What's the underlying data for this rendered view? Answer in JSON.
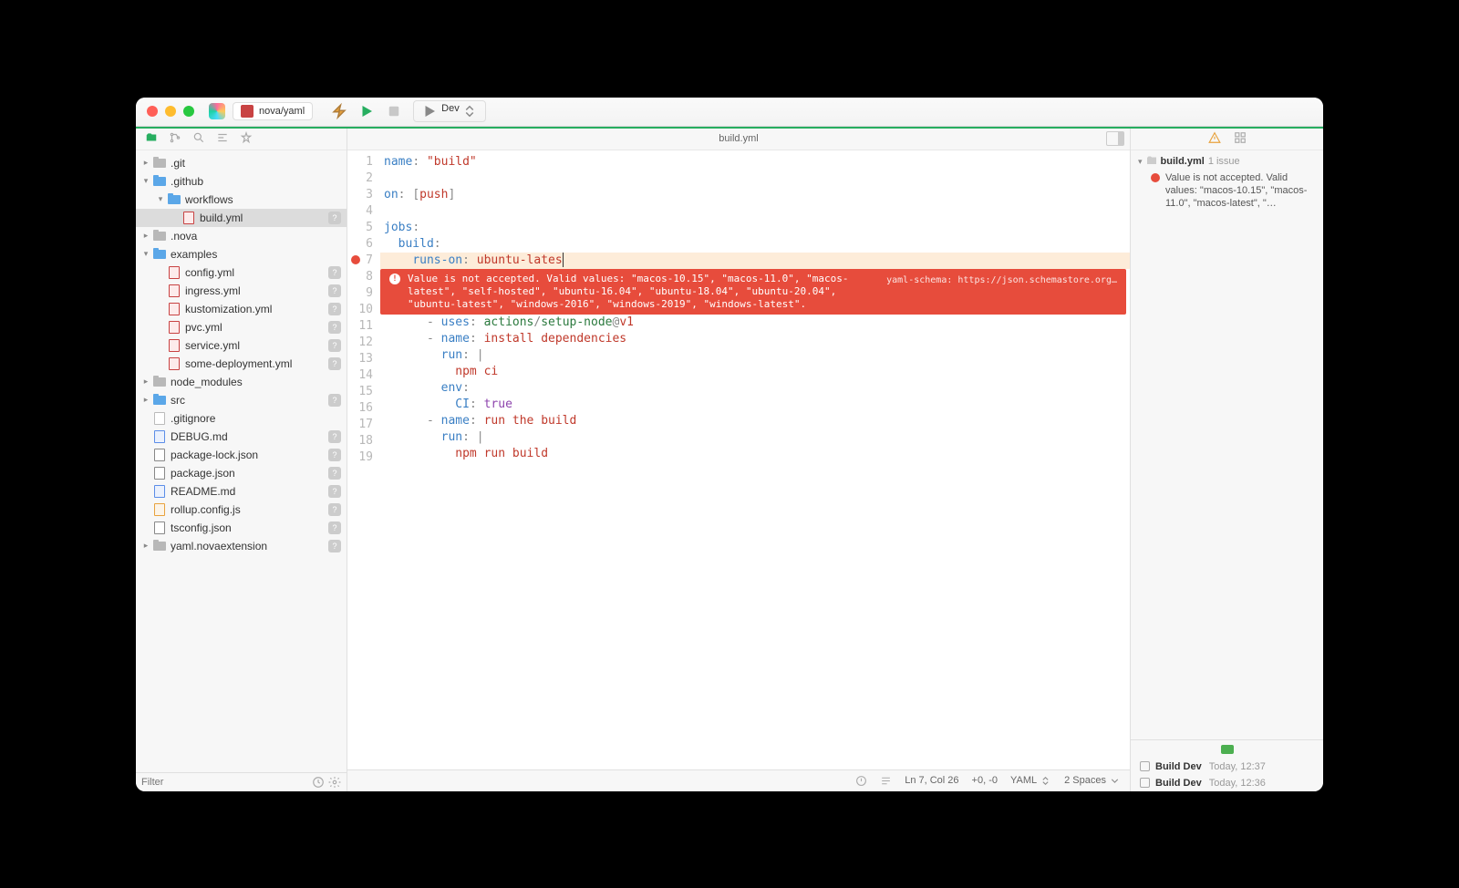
{
  "titlebar": {
    "project": "nova/yaml",
    "run_config": "Dev"
  },
  "sidebar": {
    "filter_placeholder": "Filter",
    "tree": [
      {
        "depth": 0,
        "type": "folder",
        "name": ".git",
        "expanded": false,
        "gray": true,
        "disclosure": true
      },
      {
        "depth": 0,
        "type": "folder",
        "name": ".github",
        "expanded": true,
        "disclosure": true
      },
      {
        "depth": 1,
        "type": "folder",
        "name": "workflows",
        "expanded": true,
        "disclosure": true
      },
      {
        "depth": 2,
        "type": "file",
        "name": "build.yml",
        "filetype": "yaml",
        "selected": true,
        "badge": "?"
      },
      {
        "depth": 0,
        "type": "folder",
        "name": ".nova",
        "expanded": false,
        "gray": true,
        "disclosure": true
      },
      {
        "depth": 0,
        "type": "folder",
        "name": "examples",
        "expanded": true,
        "disclosure": true
      },
      {
        "depth": 1,
        "type": "file",
        "name": "config.yml",
        "filetype": "yaml",
        "badge": "?"
      },
      {
        "depth": 1,
        "type": "file",
        "name": "ingress.yml",
        "filetype": "yaml",
        "badge": "?"
      },
      {
        "depth": 1,
        "type": "file",
        "name": "kustomization.yml",
        "filetype": "yaml",
        "badge": "?"
      },
      {
        "depth": 1,
        "type": "file",
        "name": "pvc.yml",
        "filetype": "yaml",
        "badge": "?"
      },
      {
        "depth": 1,
        "type": "file",
        "name": "service.yml",
        "filetype": "yaml",
        "badge": "?"
      },
      {
        "depth": 1,
        "type": "file",
        "name": "some-deployment.yml",
        "filetype": "yaml",
        "badge": "?"
      },
      {
        "depth": 0,
        "type": "folder",
        "name": "node_modules",
        "expanded": false,
        "gray": true,
        "disclosure": true
      },
      {
        "depth": 0,
        "type": "folder",
        "name": "src",
        "expanded": false,
        "disclosure": true,
        "badge": "?"
      },
      {
        "depth": 0,
        "type": "file",
        "name": ".gitignore",
        "filetype": "txt"
      },
      {
        "depth": 0,
        "type": "file",
        "name": "DEBUG.md",
        "filetype": "md",
        "badge": "?"
      },
      {
        "depth": 0,
        "type": "file",
        "name": "package-lock.json",
        "filetype": "json",
        "badge": "?"
      },
      {
        "depth": 0,
        "type": "file",
        "name": "package.json",
        "filetype": "json",
        "badge": "?"
      },
      {
        "depth": 0,
        "type": "file",
        "name": "README.md",
        "filetype": "md",
        "badge": "?"
      },
      {
        "depth": 0,
        "type": "file",
        "name": "rollup.config.js",
        "filetype": "js",
        "badge": "?"
      },
      {
        "depth": 0,
        "type": "file",
        "name": "tsconfig.json",
        "filetype": "json",
        "badge": "?"
      },
      {
        "depth": 0,
        "type": "folder",
        "name": "yaml.novaextension",
        "expanded": false,
        "gray": true,
        "disclosure": true,
        "badge": "?"
      }
    ]
  },
  "editor": {
    "filename": "build.yml",
    "error_line": 7,
    "error_banner": {
      "message": "Value is not accepted. Valid values: \"macos-10.15\", \"macos-11.0\", \"macos-latest\", \"self-hosted\", \"ubuntu-16.04\", \"ubuntu-18.04\", \"ubuntu-20.04\", \"ubuntu-latest\", \"windows-2016\", \"windows-2019\", \"windows-latest\".",
      "source": "yaml-schema: https://json.schemastore.org…"
    },
    "lines": [
      {
        "n": 1,
        "html": "<span class='tok-key'>name</span><span class='tok-punc'>:</span> <span class='tok-str'>\"build\"</span>"
      },
      {
        "n": 2,
        "html": ""
      },
      {
        "n": 3,
        "html": "<span class='tok-key'>on</span><span class='tok-punc'>:</span> <span class='tok-punc'>[</span><span class='tok-val'>push</span><span class='tok-punc'>]</span>"
      },
      {
        "n": 4,
        "html": ""
      },
      {
        "n": 5,
        "html": "<span class='tok-key'>jobs</span><span class='tok-punc'>:</span>"
      },
      {
        "n": 6,
        "html": "  <span class='tok-key'>build</span><span class='tok-punc'>:</span>"
      },
      {
        "n": 7,
        "html": "    <span class='tok-key'>runs-on</span><span class='tok-punc'>:</span> <span class='tok-val'>ubuntu-lates</span><span class='text-cursor'></span>",
        "err": true
      },
      {
        "n": 8,
        "banner": true
      },
      {
        "n": 9,
        "banner_cont": true
      },
      {
        "n": 10,
        "html": "      <span class='tok-punc'>-</span> <span class='tok-key'>uses</span><span class='tok-punc'>:</span> <span class='tok-fn'>actions</span><span class='tok-punc'>/</span><span class='tok-fn'>setup-node</span><span class='tok-punc'>@</span><span class='tok-val'>v1</span>"
      },
      {
        "n": 11,
        "html": "      <span class='tok-punc'>-</span> <span class='tok-key'>name</span><span class='tok-punc'>:</span> <span class='tok-val'>install dependencies</span>"
      },
      {
        "n": 12,
        "html": "        <span class='tok-key'>run</span><span class='tok-punc'>:</span> <span class='tok-punc'>|</span>"
      },
      {
        "n": 13,
        "html": "          <span class='tok-val'>npm ci</span>"
      },
      {
        "n": 14,
        "html": "        <span class='tok-key'>env</span><span class='tok-punc'>:</span>"
      },
      {
        "n": 15,
        "html": "          <span class='tok-key'>CI</span><span class='tok-punc'>:</span> <span class='tok-bool'>true</span>"
      },
      {
        "n": 16,
        "html": "      <span class='tok-punc'>-</span> <span class='tok-key'>name</span><span class='tok-punc'>:</span> <span class='tok-val'>run the build</span>"
      },
      {
        "n": 17,
        "html": "        <span class='tok-key'>run</span><span class='tok-punc'>:</span> <span class='tok-punc'>|</span>"
      },
      {
        "n": 18,
        "html": "          <span class='tok-val'>npm run build</span>"
      },
      {
        "n": 19,
        "html": ""
      }
    ]
  },
  "statusbar": {
    "cursor": "Ln 7, Col 26",
    "delta": "+0, -0",
    "lang": "YAML",
    "indent": "2 Spaces"
  },
  "rightbar": {
    "issues_file": "build.yml",
    "issues_count": "1 issue",
    "issue_text": "Value is not accepted. Valid values: \"macos-10.15\", \"macos-11.0\", \"macos-latest\", \"…",
    "runs": [
      {
        "name": "Build Dev",
        "time": "Today, 12:37"
      },
      {
        "name": "Build Dev",
        "time": "Today, 12:36"
      }
    ]
  }
}
